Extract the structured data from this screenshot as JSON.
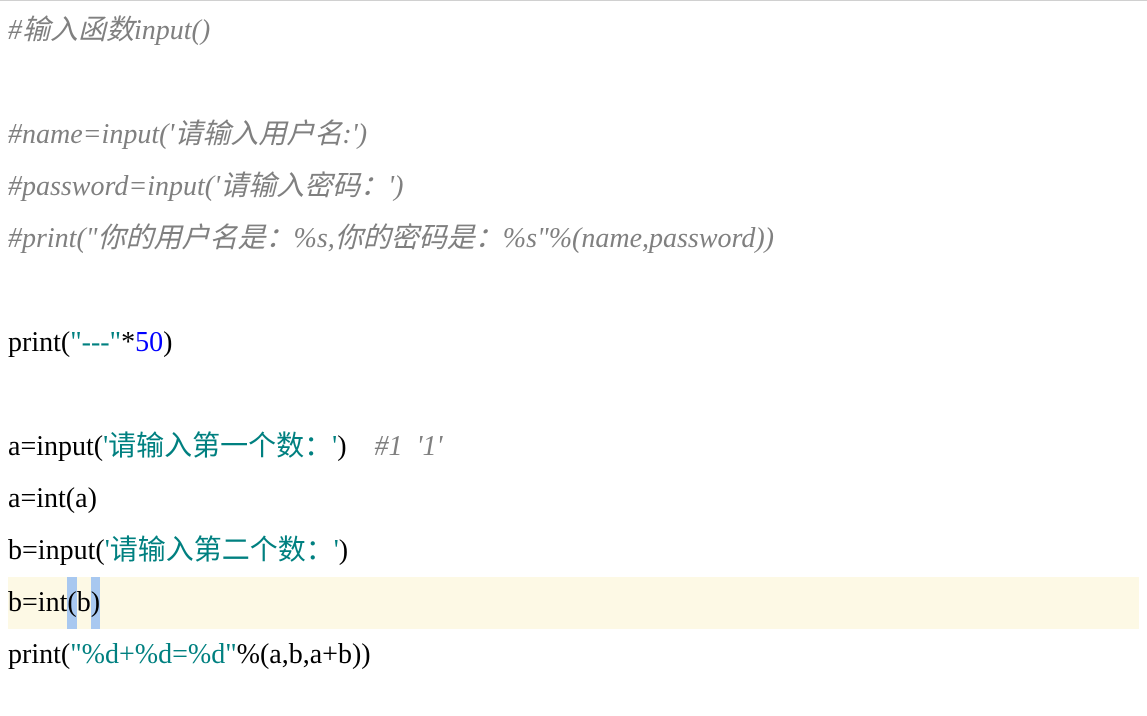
{
  "code": {
    "l1": "#输入函数input()",
    "l2": "",
    "l3_comment": "#name=input('请输入用户名:')",
    "l4_comment": "#password=input('请输入密码：')",
    "l5_comment": "#print(\"你的用户名是：%s,你的密码是：%s\"%(name,password))",
    "l6": "",
    "l7": {
      "print": "print",
      "lpar": "(",
      "str": "\"---\"",
      "star": "*",
      "num": "50",
      "rpar": ")"
    },
    "l8": "",
    "l9": {
      "a": "a",
      "eq": "=",
      "input": "input",
      "lpar": "(",
      "str": "'请输入第一个数：'",
      "rpar": ")",
      "gap": "    ",
      "comment": "#1  '1'"
    },
    "l10": {
      "a": "a",
      "eq": "=",
      "int": "int",
      "lpar": "(",
      "arg": "a",
      "rpar": ")"
    },
    "l11": {
      "b": "b",
      "eq": "=",
      "input": "input",
      "lpar": "(",
      "str": "'请输入第二个数：'",
      "rpar": ")"
    },
    "l12": {
      "b": "b",
      "eq": "=",
      "int": "int",
      "lpar": "(",
      "arg": "b",
      "rpar": ")"
    },
    "l13": {
      "print": "print",
      "lpar": "(",
      "str": "\"%d+%d=%d\"",
      "pct": "%",
      "lpar2": "(",
      "a": "a",
      "c1": ",",
      "b": "b",
      "c2": ",",
      "apb": "a+b",
      "rpar2": ")",
      "rpar": ")"
    }
  }
}
